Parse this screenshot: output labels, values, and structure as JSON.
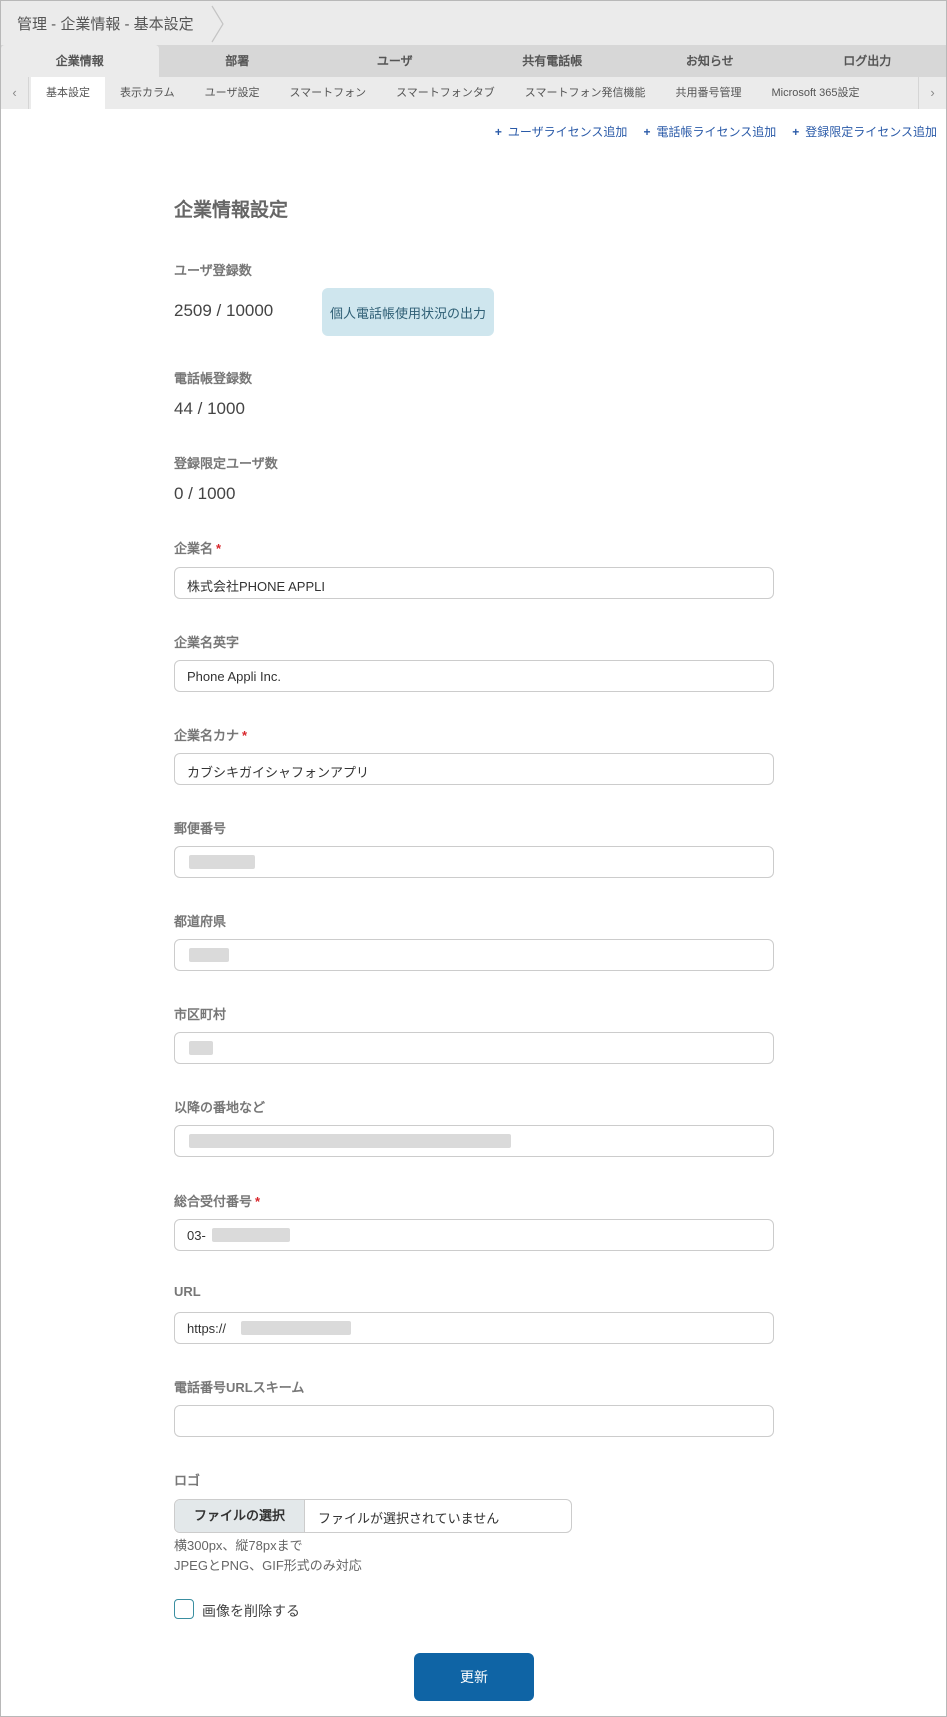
{
  "breadcrumb": "管理 - 企業情報 - 基本設定",
  "main_tabs": [
    "企業情報",
    "部署",
    "ユーザ",
    "共有電話帳",
    "お知らせ",
    "ログ出力"
  ],
  "sub_tabs": [
    "基本設定",
    "表示カラム",
    "ユーザ設定",
    "スマートフォン",
    "スマートフォンタブ",
    "スマートフォン発信機能",
    "共用番号管理",
    "Microsoft 365設定"
  ],
  "icons": {
    "prev": "chevron-left-icon",
    "next": "chevron-right-icon",
    "add": "plus-icon"
  },
  "license_links": [
    "ユーザライセンス追加",
    "電話帳ライセンス追加",
    "登録限定ライセンス追加"
  ],
  "page_title": "企業情報設定",
  "counts": {
    "user_label": "ユーザ登録数",
    "user_value": "2509 / 10000",
    "export_button": "個人電話帳使用状況の出力",
    "phonebook_label": "電話帳登録数",
    "phonebook_value": "44 / 1000",
    "limited_label": "登録限定ユーザ数",
    "limited_value": "0 / 1000"
  },
  "fields": {
    "company_name": {
      "label": "企業名",
      "value": "株式会社PHONE APPLI",
      "required": true
    },
    "company_name_en": {
      "label": "企業名英字",
      "value": "Phone Appli Inc."
    },
    "company_name_kana": {
      "label": "企業名カナ",
      "value": "カブシキガイシャフォンアプリ",
      "required": true
    },
    "postal_code": {
      "label": "郵便番号"
    },
    "prefecture": {
      "label": "都道府県"
    },
    "city": {
      "label": "市区町村"
    },
    "address": {
      "label": "以降の番地など"
    },
    "main_number": {
      "label": "総合受付番号",
      "value": "03-",
      "required": true
    },
    "url": {
      "label": "URL",
      "value": "https://"
    },
    "url_scheme": {
      "label": "電話番号URLスキーム",
      "value": ""
    }
  },
  "required_mark": "*",
  "logo": {
    "label": "ロゴ",
    "file_button": "ファイルの選択",
    "file_status": "ファイルが選択されていません",
    "hint1": "横300px、縦78pxまで",
    "hint2": "JPEGとPNG、GIF形式のみ対応",
    "delete_label": "画像を削除する"
  },
  "submit": "更新",
  "colors": {
    "accent": "#0f64a5",
    "required": "#d8262c",
    "link": "#2a5aa8",
    "export_bg": "#cfe6ee"
  }
}
